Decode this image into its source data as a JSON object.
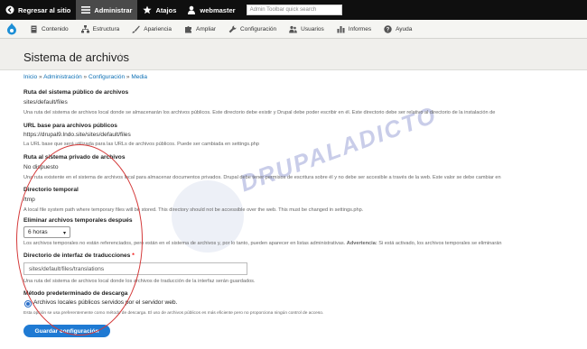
{
  "toolbar": {
    "back": "Regresar al sitio",
    "admin": "Administrar",
    "shortcuts": "Atajos",
    "user": "webmaster",
    "search_placeholder": "Admin Toolbar quick search"
  },
  "menu": {
    "items": [
      "Contenido",
      "Estructura",
      "Apariencia",
      "Ampliar",
      "Configuración",
      "Usuarios",
      "Informes",
      "Ayuda"
    ]
  },
  "page": {
    "title": "Sistema de archivos",
    "breadcrumb": [
      "Inicio",
      "Administración",
      "Configuración",
      "Media"
    ],
    "breadcrumb_sep": "»"
  },
  "fields": {
    "public_label": "Ruta del sistema público de archivos",
    "public_value": "sites/default/files",
    "public_desc": "Una ruta del sistema de archivos local donde se almacenarán los archivos públicos. Este directorio debe existir y Drupal debe poder escribir en él. Este directorio debe ser relativo al directorio de la instalación de",
    "base_label": "URL base para archivos públicos",
    "base_value": "https://drupal9.lndo.site/sites/default/files",
    "base_desc": "La URL base que será utilizada para las URLs de archivos públicos. Puede ser cambiada en settings.php",
    "private_label": "Ruta al sistema privado de archivos",
    "private_value": "No dispuesto",
    "private_desc": "Una ruta existente en el sistema de archivos local para almacenar documentos privados. Drupal debe tener permisos de escritura sobre él y no debe ser accesible a través de la web. Este valor se debe cambiar en",
    "temp_label": "Directorio temporal",
    "temp_value": "/tmp",
    "temp_desc": "A local file system path where temporary files will be stored. This directory should not be accessible over the web. This must be changed in settings.php.",
    "delete_label": "Eliminar archivos temporales después",
    "delete_value": "6 horas",
    "delete_desc": "Los archivos temporales no están referenciados, pero están en el sistema de archivos y, por lo tanto, pueden aparecer en listas administrativas.",
    "delete_warning": "Advertencia:",
    "delete_desc2": "Si está activado, los archivos temporales se eliminarán",
    "translations_label": "Directorio de interfaz de traducciones",
    "translations_required": "*",
    "translations_value": "sites/default/files/translations",
    "translations_desc": "Una ruta del sistema de archivos local donde los archivos de traducción de la interfaz serán guardados.",
    "download_label": "Método predeterminado de descarga",
    "download_option": "Archivos locales públicos servidos por el servidor web.",
    "download_desc": "Esta opción se usa preferentemente como método de descarga. El uso de archivos públicos es más eficiente pero no proporciona ningún control de acceso.",
    "save_button": "Guardar configuración"
  },
  "watermark": "DRUPALADICTO",
  "colors": {
    "accent": "#1f7ad3",
    "toolbar": "#0f0f0f",
    "annotation": "#d43a3a"
  }
}
